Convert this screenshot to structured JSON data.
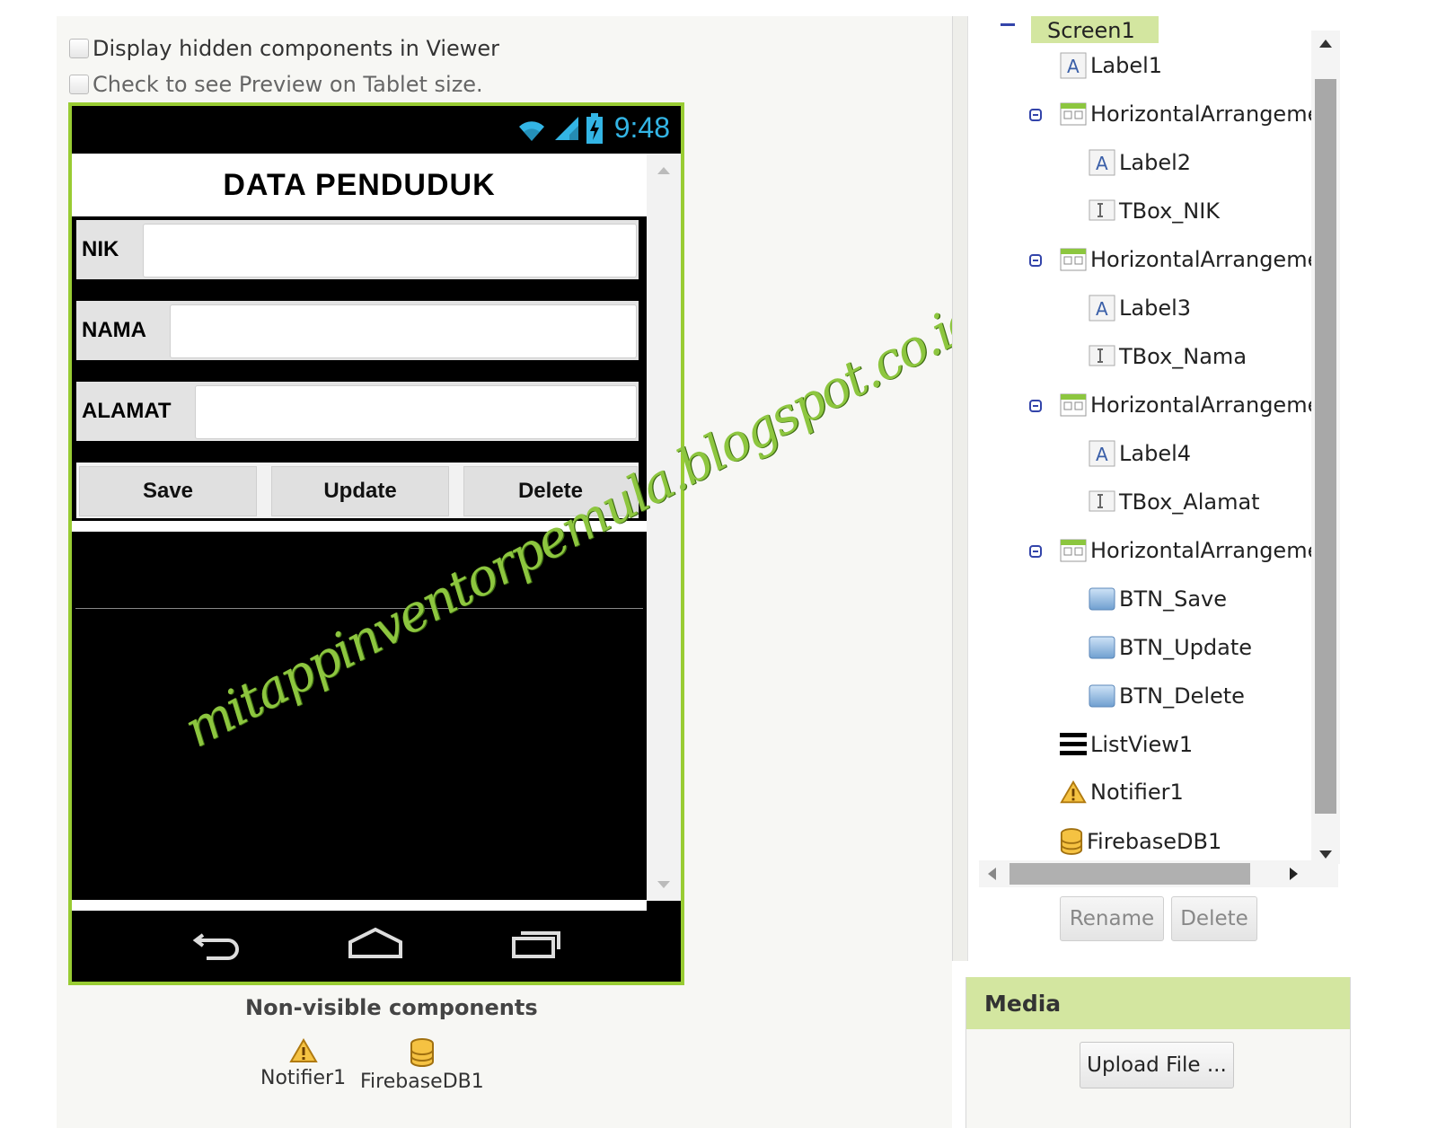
{
  "viewer": {
    "display_hidden_label": "Display hidden components in Viewer",
    "tablet_preview_label": "Check to see Preview on Tablet size."
  },
  "phone": {
    "status_time": "9:48",
    "title": "DATA PENDUDUK",
    "fields": [
      {
        "label": "NIK",
        "value": ""
      },
      {
        "label": "NAMA",
        "value": ""
      },
      {
        "label": "ALAMAT",
        "value": ""
      }
    ],
    "buttons": {
      "save": "Save",
      "update": "Update",
      "delete": "Delete"
    }
  },
  "watermark": "mitappinventorpemula.blogspot.co.id",
  "nonvisible": {
    "title": "Non-visible components",
    "items": [
      "Notifier1",
      "FirebaseDB1"
    ]
  },
  "tree": {
    "root": "Screen1",
    "items": [
      {
        "label": "Label1",
        "icon": "label-icon"
      },
      {
        "label": "HorizontalArrangemen",
        "icon": "horizontal-arrangement-icon"
      },
      {
        "label": "Label2",
        "icon": "label-icon"
      },
      {
        "label": "TBox_NIK",
        "icon": "textbox-icon"
      },
      {
        "label": "HorizontalArrangemen",
        "icon": "horizontal-arrangement-icon"
      },
      {
        "label": "Label3",
        "icon": "label-icon"
      },
      {
        "label": "TBox_Nama",
        "icon": "textbox-icon"
      },
      {
        "label": "HorizontalArrangemen",
        "icon": "horizontal-arrangement-icon"
      },
      {
        "label": "Label4",
        "icon": "label-icon"
      },
      {
        "label": "TBox_Alamat",
        "icon": "textbox-icon"
      },
      {
        "label": "HorizontalArrangemen",
        "icon": "horizontal-arrangement-icon"
      },
      {
        "label": "BTN_Save",
        "icon": "button-icon"
      },
      {
        "label": "BTN_Update",
        "icon": "button-icon"
      },
      {
        "label": "BTN_Delete",
        "icon": "button-icon"
      },
      {
        "label": "ListView1",
        "icon": "listview-icon"
      },
      {
        "label": "Notifier1",
        "icon": "warning-icon"
      },
      {
        "label": "FirebaseDB1",
        "icon": "database-icon"
      }
    ],
    "rename_label": "Rename",
    "delete_label": "Delete"
  },
  "media": {
    "title": "Media",
    "upload_label": "Upload File ..."
  },
  "colors": {
    "accent_green": "#99cc33",
    "header_green": "#d3e6a0",
    "status_blue": "#33b5e5",
    "watermark_green": "#8dc63f"
  }
}
